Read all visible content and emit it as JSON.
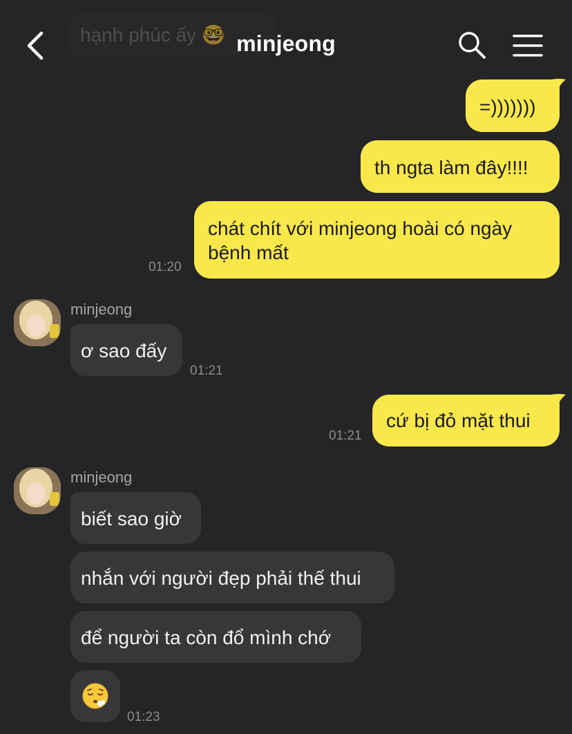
{
  "header": {
    "title": "minjeong",
    "pinned_preview": "hạnh phúc ấy 🤓"
  },
  "messages": {
    "m1": "=)))))))",
    "m2": "th ngta làm đây!!!!",
    "m3_line1": "chát chít với minjeong hoài có ngày",
    "m3_line2": "bệnh mất",
    "t1": "01:20",
    "sender1": "minjeong",
    "r1": "ơ sao đấy",
    "t2": "01:21",
    "m4": "cứ bị đỏ mặt thui",
    "t3": "01:21",
    "sender2": "minjeong",
    "r2": "biết sao giờ",
    "r3": "nhắn với người đẹp phải thế thui",
    "r4": "để người ta còn đổ mình chớ",
    "r5_emoji": "face-exhaling-emoji",
    "t4": "01:23"
  },
  "colors": {
    "background": "#252527",
    "my_bubble": "#fae84b",
    "their_bubble": "#37373a"
  }
}
